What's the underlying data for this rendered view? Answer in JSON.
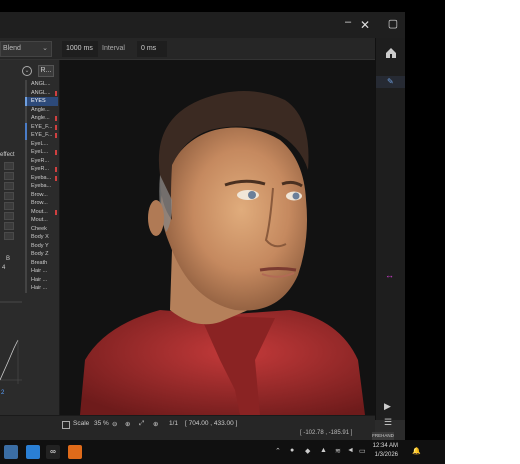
{
  "toolbar": {
    "blend_combo": "Blend",
    "duration_value": "1000 ms",
    "interval_label": "Interval",
    "interval_value": "0 ms"
  },
  "left_panel": {
    "reset_button": "R...",
    "effect_label": "effect",
    "playback_label": "B",
    "playback_value": "4",
    "curve_value": "2"
  },
  "parameter_list": [
    {
      "label": "ANGL...",
      "style": "normal"
    },
    {
      "label": "ANGL...",
      "style": "normal"
    },
    {
      "label": "EYES",
      "style": "highlight"
    },
    {
      "label": "Angle...",
      "style": "normal"
    },
    {
      "label": "Angle...",
      "style": "normal"
    },
    {
      "label": "EYE_F...",
      "style": "blue"
    },
    {
      "label": "EYE_F...",
      "style": "blue"
    },
    {
      "label": "EyeL...",
      "style": "normal"
    },
    {
      "label": "EyeL...",
      "style": "normal"
    },
    {
      "label": "EyeR...",
      "style": "normal"
    },
    {
      "label": "EyeR...",
      "style": "normal"
    },
    {
      "label": "Eyeba...",
      "style": "normal"
    },
    {
      "label": "Eyeba...",
      "style": "normal"
    },
    {
      "label": "Brow...",
      "style": "normal"
    },
    {
      "label": "Brow...",
      "style": "normal"
    },
    {
      "label": "Mout...",
      "style": "normal"
    },
    {
      "label": "Mout...",
      "style": "normal"
    },
    {
      "label": "Cheek",
      "style": "normal"
    },
    {
      "label": "Body X",
      "style": "normal"
    },
    {
      "label": "Body Y",
      "style": "normal"
    },
    {
      "label": "Body Z",
      "style": "normal"
    },
    {
      "label": "Breath",
      "style": "normal"
    },
    {
      "label": "Hair ...",
      "style": "normal"
    },
    {
      "label": "Hair ...",
      "style": "normal"
    },
    {
      "label": "Hair ...",
      "style": "normal"
    }
  ],
  "status_bar": {
    "scale_label": "Scale",
    "scale_value": "35 %",
    "page_value": "1/1",
    "cursor_coords": "[ 704.00 , 433.00 ]",
    "bottom_coords": "[ -102.78 , -185.91 ]",
    "mode_pill": "FREHAND"
  },
  "taskbar": {
    "time": "12:34 AM",
    "date": "1/3/2026"
  },
  "colors": {
    "app_bg": "#2b2b2b",
    "canvas_bg": "#121212",
    "highlight": "#2d4a7a",
    "accent_magenta": "#d23fd2",
    "marker_red": "#d04040",
    "shirt_red": "#9a2a2a"
  }
}
